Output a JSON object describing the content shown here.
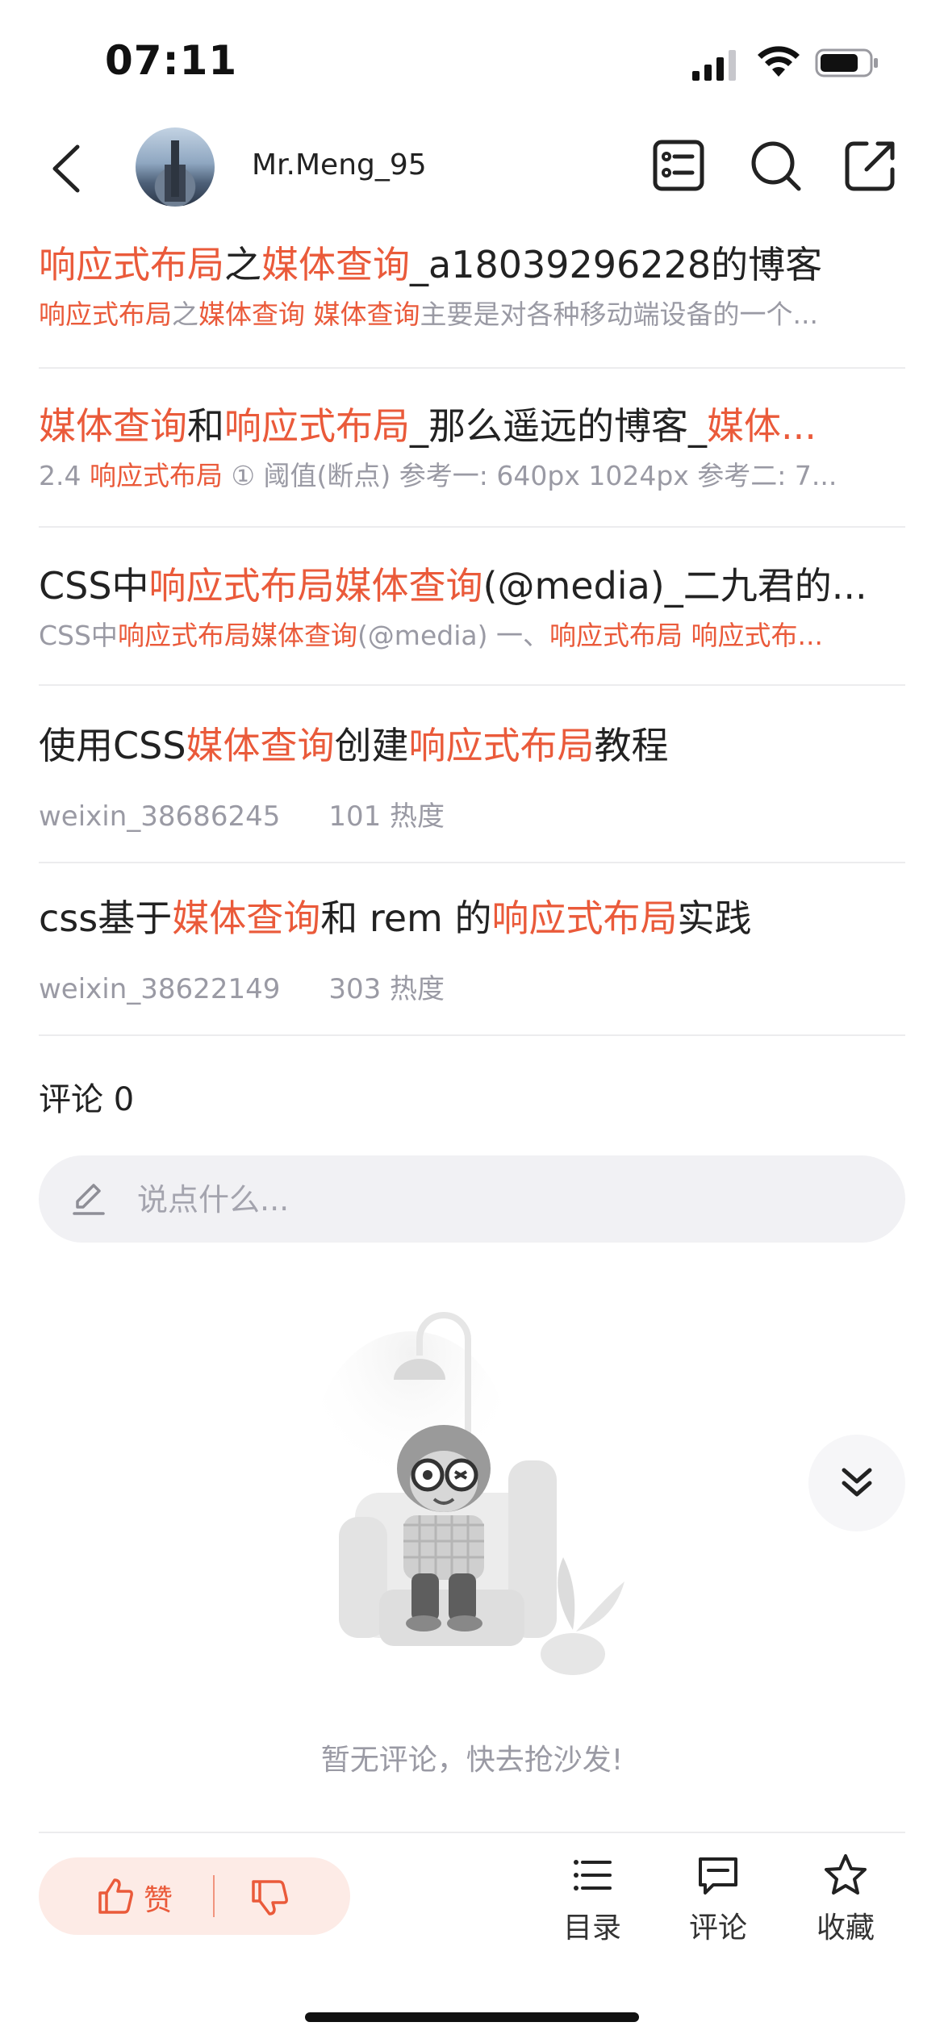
{
  "status_bar": {
    "time": "07:11"
  },
  "header": {
    "username": "Mr.Meng_95"
  },
  "results": [
    {
      "title_parts": [
        {
          "t": "响应式布局",
          "hl": true
        },
        {
          "t": "之",
          "hl": false
        },
        {
          "t": "媒体查询",
          "hl": true
        },
        {
          "t": "_a18039296228的博客",
          "hl": false
        }
      ],
      "sub_parts": [
        {
          "t": "响应式布局",
          "hl": true
        },
        {
          "t": "之",
          "hl": false
        },
        {
          "t": "媒体查询",
          "hl": true
        },
        {
          "t": " ",
          "hl": false
        },
        {
          "t": "媒体查询",
          "hl": true
        },
        {
          "t": "主要是对各种移动端设备的一个...",
          "hl": false
        }
      ]
    },
    {
      "title_parts": [
        {
          "t": "媒体查询",
          "hl": true
        },
        {
          "t": "和",
          "hl": false
        },
        {
          "t": "响应式布局",
          "hl": true
        },
        {
          "t": "_那么遥远的博客_",
          "hl": false
        },
        {
          "t": "媒体...",
          "hl": true
        }
      ],
      "sub_parts": [
        {
          "t": "2.4 ",
          "hl": false
        },
        {
          "t": "响应式布局",
          "hl": true
        },
        {
          "t": " ① 阈值(断点) 参考一: 640px 1024px 参考二: 7...",
          "hl": false
        }
      ]
    },
    {
      "title_parts": [
        {
          "t": "CSS中",
          "hl": false
        },
        {
          "t": "响应式布局媒体查询",
          "hl": true
        },
        {
          "t": "(@media)_二九君的...",
          "hl": false
        }
      ],
      "sub_parts": [
        {
          "t": "CSS中",
          "hl": false
        },
        {
          "t": "响应式布局媒体查询",
          "hl": true
        },
        {
          "t": "(@media) 一、",
          "hl": false
        },
        {
          "t": "响应式布局",
          "hl": true
        },
        {
          "t": " ",
          "hl": false
        },
        {
          "t": "响应式布...",
          "hl": true
        }
      ]
    },
    {
      "title_parts": [
        {
          "t": "使用CSS",
          "hl": false
        },
        {
          "t": "媒体查询",
          "hl": true
        },
        {
          "t": "创建",
          "hl": false
        },
        {
          "t": "响应式布局",
          "hl": true
        },
        {
          "t": "教程",
          "hl": false
        }
      ],
      "author": "weixin_38686245",
      "heat": "101 热度"
    },
    {
      "title_parts": [
        {
          "t": "css基于",
          "hl": false
        },
        {
          "t": "媒体查询",
          "hl": true
        },
        {
          "t": "和 rem 的",
          "hl": false
        },
        {
          "t": "响应式布局",
          "hl": true
        },
        {
          "t": "实践",
          "hl": false
        }
      ],
      "author": "weixin_38622149",
      "heat": "303 热度"
    }
  ],
  "comments": {
    "label": "评论 0",
    "placeholder": "说点什么...",
    "empty_text": "暂无评论，快去抢沙发!"
  },
  "bottom_bar": {
    "like_label": "赞",
    "toc_label": "目录",
    "comment_label": "评论",
    "favorite_label": "收藏"
  },
  "colors": {
    "accent": "#ea5a3a",
    "muted": "#9a9aa4",
    "pill_bg": "#fdebe6"
  }
}
